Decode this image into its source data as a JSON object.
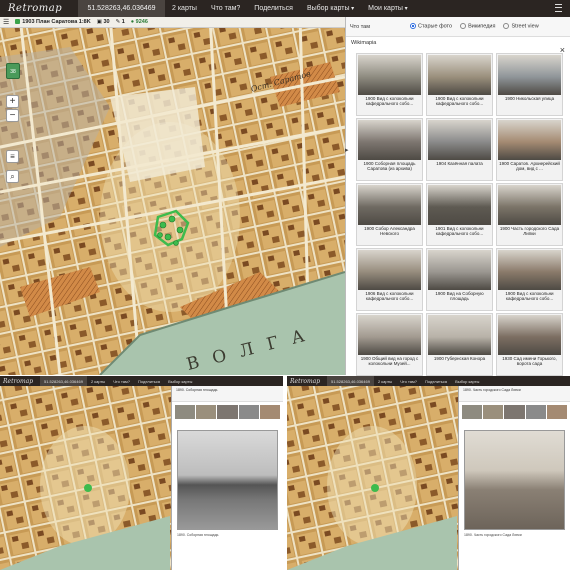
{
  "app": {
    "logo": "Retromap",
    "coords": "51.528263,46.036469",
    "nav": [
      "2 карты",
      "Что там?",
      "Поделиться",
      "Выбор карты",
      "Мои карты"
    ]
  },
  "infobar": {
    "map_name": "1903 План Саратова 1:8K",
    "count1": "30",
    "count2": "1",
    "count3": "9246"
  },
  "map": {
    "controls": {
      "layers_btn": "38",
      "zoom_in": "+",
      "zoom_out": "−"
    },
    "river_label": "ВОЛГА",
    "street_label": "Ост. Саратов"
  },
  "panel": {
    "tab_label": "Что там",
    "radios": [
      "Старые фото",
      "Википедия",
      "Street view"
    ],
    "wiki_label": "Wikimapia",
    "close": "×",
    "photos": [
      {
        "caption": "1900 Вид с колокольни кафедрального собо...",
        "tone": "#8e8b80"
      },
      {
        "caption": "1900 Вид с колокольни кафедрального собо...",
        "tone": "#9a8f7c"
      },
      {
        "caption": "1900 Никольская улица",
        "tone": "#8f9599"
      },
      {
        "caption": "1900 Соборная площадь Саратова (из архива)",
        "tone": "#7d7670"
      },
      {
        "caption": "1904 Казённая палата",
        "tone": "#8a8a8a"
      },
      {
        "caption": "1900 Саратов. Архиерейский дом, вид с ...",
        "tone": "#a48a72"
      },
      {
        "caption": "1900 Собор Александра Невского",
        "tone": "#6f6a62"
      },
      {
        "caption": "1901 Вид с колокольни кафедрального собо...",
        "tone": "#5e5a52"
      },
      {
        "caption": "1900 Часть городского Сада Липки",
        "tone": "#7b7468"
      },
      {
        "caption": "1906 Вид с колокольни кафедрального собо...",
        "tone": "#968c7d"
      },
      {
        "caption": "1900 Вид на Соборную площадь",
        "tone": "#9a9690"
      },
      {
        "caption": "1900 Вид с колокольни кафедрального собо...",
        "tone": "#8a7a6a"
      },
      {
        "caption": "1900 Общий вид на город с колокольни Музей...",
        "tone": "#a29a90"
      },
      {
        "caption": "1900 Губернская Конора",
        "tone": "#b8b2a8"
      },
      {
        "caption": "1930 Сад имени Горького, ворота сада",
        "tone": "#7c6e62"
      }
    ]
  },
  "mini_left": {
    "logo": "Retromap",
    "coords": "51.528263,46.036469",
    "nav": [
      "2 карты",
      "Что там?",
      "Поделиться",
      "Выбор карты"
    ],
    "title": "1890. Соборная площадь",
    "caption": "1890. Соборная площадь"
  },
  "mini_right": {
    "logo": "Retromap",
    "coords": "51.528263,46.036469",
    "nav": [
      "2 карты",
      "Что там?",
      "Поделиться",
      "Выбор карты"
    ],
    "title": "1890. Часть городского Сада Липки",
    "caption": "1890. Часть городского Сада Липки"
  }
}
